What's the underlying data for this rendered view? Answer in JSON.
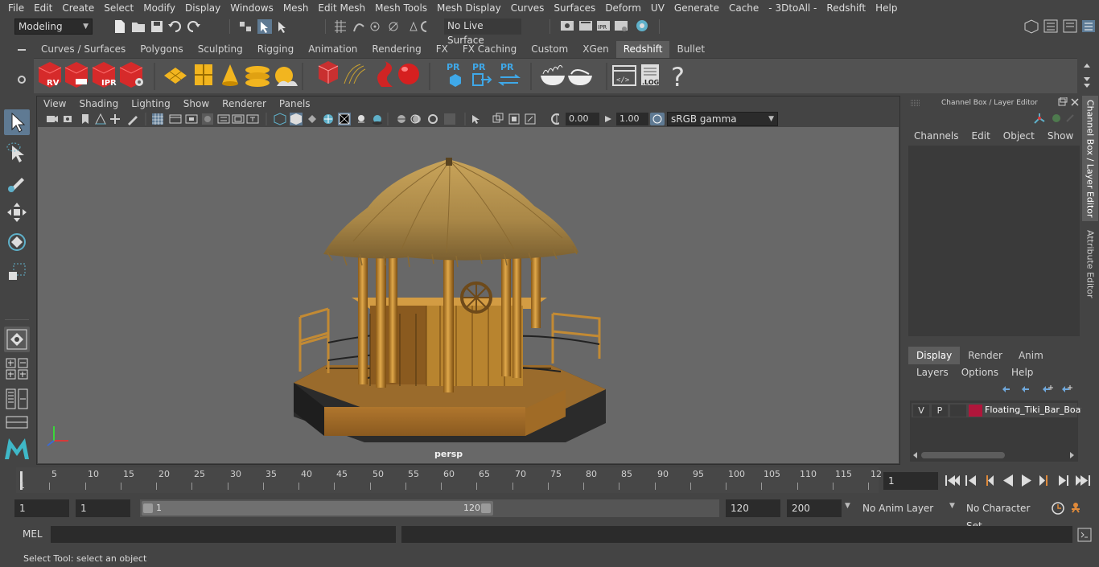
{
  "menu": [
    "File",
    "Edit",
    "Create",
    "Select",
    "Modify",
    "Display",
    "Windows",
    "Mesh",
    "Edit Mesh",
    "Mesh Tools",
    "Mesh Display",
    "Curves",
    "Surfaces",
    "Deform",
    "UV",
    "Generate",
    "Cache",
    "- 3DtoAll -",
    "Redshift",
    "Help"
  ],
  "statusline": {
    "mode": "Modeling",
    "live_surface": "No Live Surface"
  },
  "shelf": {
    "tabs": [
      "Curves / Surfaces",
      "Polygons",
      "Sculpting",
      "Rigging",
      "Animation",
      "Rendering",
      "FX",
      "FX Caching",
      "Custom",
      "XGen",
      "Redshift",
      "Bullet"
    ],
    "active_tab": "Redshift",
    "icon_labels": {
      "rv": "RV",
      "ipr": "IPR",
      "pr": "PR",
      "log": ".LOG",
      "help": "?"
    }
  },
  "viewport": {
    "menu": [
      "View",
      "Shading",
      "Lighting",
      "Show",
      "Renderer",
      "Panels"
    ],
    "exposure": "0.00",
    "gamma": "1.00",
    "color_space": "sRGB gamma",
    "camera_label": "persp"
  },
  "channel_box": {
    "title": "Channel Box / Layer Editor",
    "menu": [
      "Channels",
      "Edit",
      "Object",
      "Show"
    ]
  },
  "layer_editor": {
    "tabs": [
      "Display",
      "Render",
      "Anim"
    ],
    "active_tab": "Display",
    "menu": [
      "Layers",
      "Options",
      "Help"
    ],
    "layers": [
      {
        "v": "V",
        "p": "P",
        "color": "#b0163b",
        "name": "Floating_Tiki_Bar_Boat"
      }
    ]
  },
  "side_tabs": [
    "Channel Box / Layer Editor",
    "Attribute Editor"
  ],
  "timeline": {
    "ticks": [
      "5",
      "10",
      "15",
      "20",
      "25",
      "30",
      "35",
      "40",
      "45",
      "50",
      "55",
      "60",
      "65",
      "70",
      "75",
      "80",
      "85",
      "90",
      "95",
      "100",
      "105",
      "110",
      "115",
      "12"
    ],
    "start_label": "1",
    "current_frame": "1"
  },
  "range": {
    "start": "1",
    "playback_start": "1",
    "slider_start": "1",
    "slider_end": "120",
    "playback_end": "120",
    "end": "200",
    "anim_layer": "No Anim Layer",
    "character_set": "No Character Set"
  },
  "command_line": {
    "label": "MEL"
  },
  "help_line": "Select Tool: select an object"
}
